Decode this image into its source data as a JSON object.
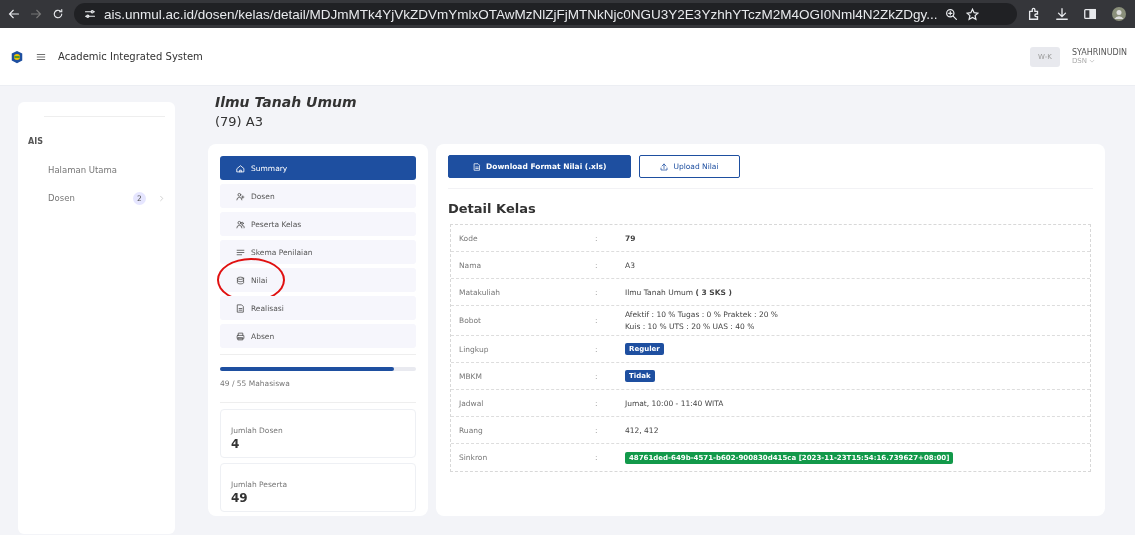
{
  "browser": {
    "url": "ais.unmul.ac.id/dosen/kelas/detail/MDJmMTk4YjVkZDVmYmlxOTAwMzNlZjFjMTNkNjc0NGU3Y2E3YzhhYTczM2M4OGI0Nml4N2ZkZDgy..."
  },
  "header": {
    "app_title": "Academic Integrated System",
    "user_initials": "W-K",
    "user_name": "SYAHRINUDIN",
    "user_role": "DSN"
  },
  "sidebar": {
    "section": "AIS",
    "items": [
      {
        "label": "Halaman Utama",
        "selected": false
      },
      {
        "label": "Dosen",
        "selected": false,
        "badge": "2"
      }
    ]
  },
  "page": {
    "title": "Ilmu Tanah Umum",
    "subtitle": "(79) A3"
  },
  "class_menu": [
    {
      "label": "Summary",
      "kind": "home",
      "selected": true
    },
    {
      "label": "Dosen",
      "kind": "user",
      "selected": false
    },
    {
      "label": "Peserta Kelas",
      "kind": "users",
      "selected": false
    },
    {
      "label": "Skema Penilaian",
      "kind": "list",
      "selected": false
    },
    {
      "label": "Nilai",
      "kind": "database",
      "selected": false,
      "annotated": true
    },
    {
      "label": "Realisasi",
      "kind": "file",
      "selected": false
    },
    {
      "label": "Absen",
      "kind": "print",
      "selected": false
    }
  ],
  "progress": {
    "level": 0.89,
    "reading": "49 / 55 Mahasiswa"
  },
  "stats": [
    {
      "label": "Jumlah Dosen",
      "value": "4"
    },
    {
      "label": "Jumlah Peserta",
      "value": "49"
    }
  ],
  "actions": [
    {
      "label": "Download Format Nilai (.xls)",
      "kind": "primary"
    },
    {
      "label": "Upload Nilai",
      "kind": "outline"
    }
  ],
  "detail": {
    "title": "Detail Kelas",
    "separator": ":",
    "rows": [
      {
        "label": "Kode",
        "kind": "bold",
        "value": "79"
      },
      {
        "label": "Nama",
        "kind": "text",
        "value": "A3"
      },
      {
        "label": "Matakuliah",
        "kind": "rich",
        "value": "Ilmu Tanah Umum **( 3 SKS )**"
      },
      {
        "label": "Bobot",
        "kind": "lines",
        "lines": [
          "Afektif : 10 % Tugas : 0 % Praktek : 20 %",
          "Kuis : 10 % UTS : 20 % UAS : 40 %"
        ]
      },
      {
        "label": "Lingkup",
        "kind": "badge",
        "value": "Reguler",
        "color": "#1e4fa0"
      },
      {
        "label": "MBKM",
        "kind": "badge",
        "value": "Tidak",
        "color": "#1e4fa0"
      },
      {
        "label": "Jadwal",
        "kind": "text",
        "value": "Jumat, 10:00 - 11:40 WITA"
      },
      {
        "label": "Ruang",
        "kind": "text",
        "value": "412, 412"
      },
      {
        "label": "Sinkron",
        "kind": "badge",
        "value": "48761ded-649b-4571-b602-900830d415ca [2023-11-23T15:54:16.739627+08:00]",
        "color": "#12994a"
      }
    ]
  }
}
